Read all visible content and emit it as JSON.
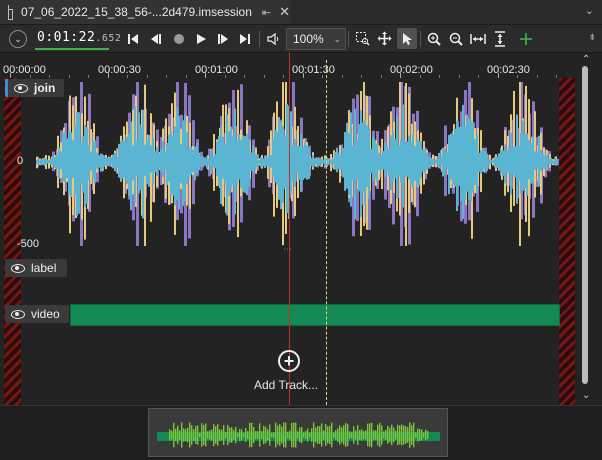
{
  "tab": {
    "title": "07_06_2022_15_38_56-...2d479.imsession",
    "pin_glyph": "⇤",
    "close_glyph": "✕",
    "menu_glyph": "⌄"
  },
  "toolbar": {
    "menu_glyph": "⌄",
    "timecode_main": "0:01:22",
    "timecode_fraction": ".652",
    "zoom_value": "100%",
    "zoom_caret": "⌄",
    "overflow_glyph": "⇟",
    "icons": [
      "skip-to-start-icon",
      "step-back-icon",
      "record-icon",
      "play-icon",
      "step-forward-icon",
      "skip-to-end-icon",
      "volume-icon",
      "select-region-icon",
      "move-icon",
      "pointer-icon",
      "zoom-in-icon",
      "zoom-out-icon",
      "fit-horizontal-icon",
      "fit-vertical-icon",
      "add-icon"
    ]
  },
  "ruler": {
    "labels": [
      "00:00:00",
      "00:00:30",
      "00:01:00",
      "00:01:30",
      "00:02:00",
      "00:02:30"
    ]
  },
  "tracks": {
    "join": {
      "label": "join",
      "amp_max": "",
      "amp_zero": "0",
      "amp_min": "-500"
    },
    "label": {
      "label": "label"
    },
    "video": {
      "label": "video"
    }
  },
  "add_track": {
    "label": "Add Track...",
    "glyph": "+"
  },
  "scroll": {
    "up": "⌃",
    "down": "⌄"
  },
  "colors": {
    "accent_green": "#3bb54a",
    "video_bar": "#138a52",
    "wave_purple": "#8a76c4",
    "wave_yellow": "#e7c97b",
    "wave_cyan": "#5ab5d3",
    "playhead": "#c0302b"
  }
}
